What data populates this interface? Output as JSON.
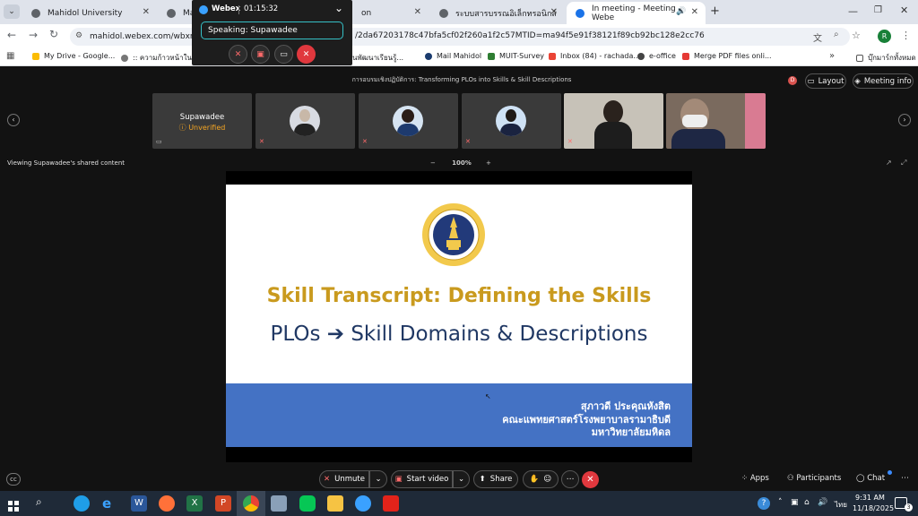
{
  "browser": {
    "tabs": [
      {
        "label": "Mahidol University"
      },
      {
        "label": "Mah"
      },
      {
        "label": "on"
      },
      {
        "label": "ระบบสารบรรณอิเล็กทรอนิกส์"
      },
      {
        "label": "In meeting - Meeting - Webe"
      }
    ],
    "url": "mahidol.webex.com/wbxmjs/",
    "url_tail": "/2da67203178c47bfa5cf02f260a1f2c57MTID=ma94f5e91f38121f89cb92bc128e2cc76",
    "bookmarks": [
      {
        "label": "My Drive - Google..."
      },
      {
        "label": ":: ความก้าวหน้าในตำแ"
      },
      {
        "label": "ุนพัฒนาเรียนรู้..."
      },
      {
        "label": "Mail Mahidol"
      },
      {
        "label": "MUIT-Survey"
      },
      {
        "label": "Inbox (84) - rachada..."
      },
      {
        "label": "e-office"
      },
      {
        "label": "Merge PDF files onli..."
      }
    ],
    "bookmarks_more": "»",
    "all_bookmarks": "บุ๊กมาร์กทั้งหมด",
    "profile_initial": "R"
  },
  "webex_mini": {
    "app_name": "Webex",
    "timer": "01:15:32",
    "speaking": "Speaking: Supawadee"
  },
  "meeting": {
    "title": "การอบรมเชิงปฏิบัติการ: Transforming PLOs into Skills & Skill Descriptions",
    "layout_label": "Layout",
    "info_label": "Meeting info",
    "participants": [
      {
        "name": "Supawadee",
        "status": "Unverified"
      }
    ],
    "viewing_label": "Viewing Supawadee's shared content",
    "zoom_minus": "−",
    "zoom_value": "100%",
    "zoom_plus": "+"
  },
  "slide": {
    "title": "Skill Transcript: Defining the Skills",
    "subtitle": "PLOs ➔ Skill Domains & Descriptions",
    "presenter_name": "สุภาวดี  ประคุณหังสิต",
    "faculty": "คณะแพทยศาสตร์โรงพยาบาลรามาธิบดี",
    "university": "มหาวิทยาลัยมหิดล"
  },
  "controls": {
    "unmute": "Unmute",
    "start_video": "Start video",
    "share": "Share",
    "apps": "Apps",
    "participants": "Participants",
    "chat": "Chat"
  },
  "taskbar": {
    "time": "9:31 AM",
    "date": "11/18/2025",
    "lang": "ไทย",
    "notif_count": "3"
  },
  "colors": {
    "accent_teal": "#35c0c6",
    "end_red": "#e0383e",
    "slide_gold": "#c99a1e",
    "slide_navy": "#203864",
    "slide_blue": "#4472c4"
  }
}
